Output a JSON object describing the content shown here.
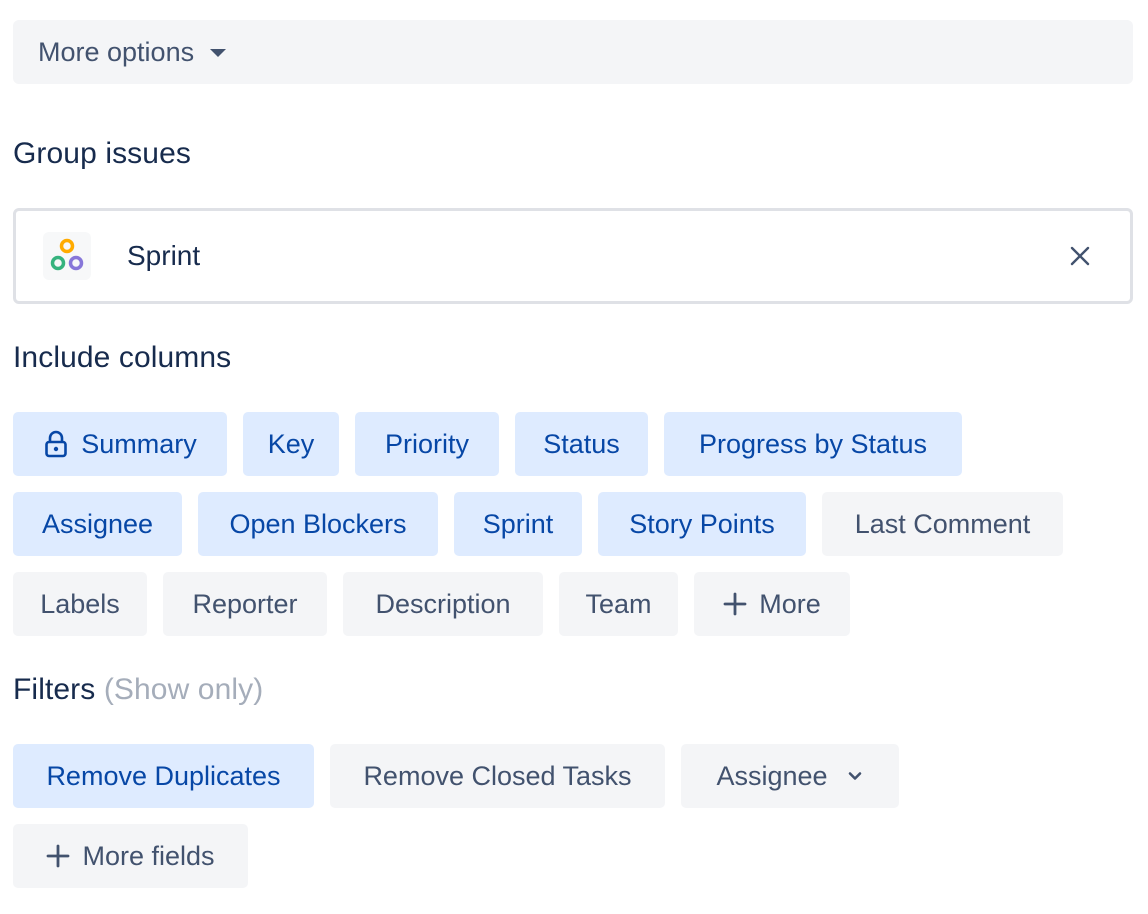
{
  "more_options": {
    "label": "More options"
  },
  "group_issues": {
    "title": "Group issues",
    "selected": "Sprint"
  },
  "include_columns": {
    "title": "Include columns",
    "chips": [
      {
        "label": "Summary",
        "selected": true,
        "locked": true
      },
      {
        "label": "Key",
        "selected": true
      },
      {
        "label": "Priority",
        "selected": true
      },
      {
        "label": "Status",
        "selected": true
      },
      {
        "label": "Progress by Status",
        "selected": true
      },
      {
        "label": "Assignee",
        "selected": true
      },
      {
        "label": "Open Blockers",
        "selected": true
      },
      {
        "label": "Sprint",
        "selected": true
      },
      {
        "label": "Story Points",
        "selected": true
      },
      {
        "label": "Last Comment",
        "selected": false
      },
      {
        "label": "Labels",
        "selected": false
      },
      {
        "label": "Reporter",
        "selected": false
      },
      {
        "label": "Description",
        "selected": false
      },
      {
        "label": "Team",
        "selected": false
      },
      {
        "label": "More",
        "selected": false,
        "icon": "plus-icon"
      }
    ]
  },
  "filters": {
    "title": "Filters",
    "subtitle": "(Show only)",
    "chips": [
      {
        "label": "Remove Duplicates",
        "selected": true
      },
      {
        "label": "Remove Closed Tasks",
        "selected": false
      },
      {
        "label": "Assignee",
        "selected": false,
        "icon": "chevron-down-icon"
      },
      {
        "label": "More fields",
        "selected": false,
        "icon": "plus-icon"
      }
    ]
  },
  "colors": {
    "selected_bg": "#deebff",
    "selected_text": "#0747a6",
    "neutral_bg": "#f4f5f7",
    "neutral_text": "#42526e",
    "heading": "#172b4d",
    "muted": "#a5adba"
  }
}
